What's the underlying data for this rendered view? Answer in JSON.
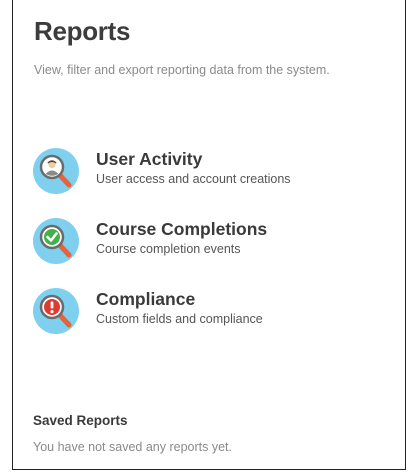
{
  "header": {
    "title": "Reports",
    "subtitle": "View, filter and export reporting data from the system."
  },
  "reports": [
    {
      "title": "User Activity",
      "description": "User access and account creations",
      "icon": "user-magnifier-icon"
    },
    {
      "title": "Course Completions",
      "description": "Course completion events",
      "icon": "checkmark-magnifier-icon"
    },
    {
      "title": "Compliance",
      "description": "Custom fields and compliance",
      "icon": "alert-magnifier-icon"
    }
  ],
  "saved": {
    "heading": "Saved Reports",
    "empty_message": "You have not saved any reports yet."
  },
  "colors": {
    "icon_background": "#7fd0ee",
    "magnifier_handle": "#e8623a",
    "check_green": "#43b04a",
    "alert_red": "#e03a2f"
  }
}
